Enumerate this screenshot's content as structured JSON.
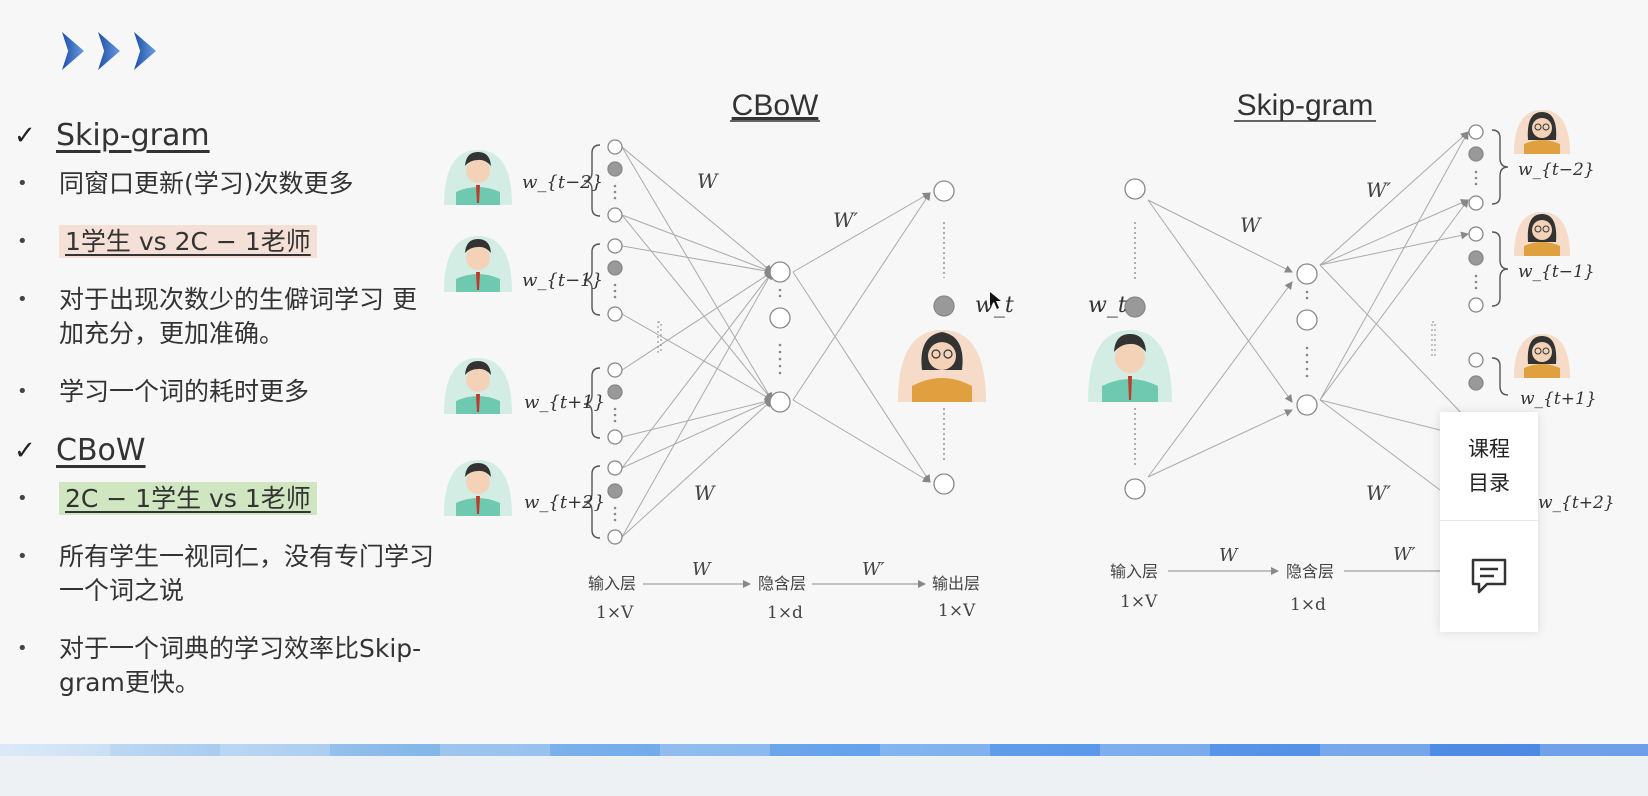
{
  "left": {
    "sections": [
      {
        "title": "Skip-gram",
        "bullets": [
          {
            "text": "同窗口更新(学习)次数更多",
            "highlight": ""
          },
          {
            "text": "1学生 vs 2C − 1老师",
            "highlight": "pink"
          },
          {
            "text": "对于出现次数少的生僻词学习 更加充分，更加准确。",
            "highlight": ""
          },
          {
            "text": "学习一个词的耗时更多",
            "highlight": ""
          }
        ]
      },
      {
        "title": "CBoW",
        "bullets": [
          {
            "text": "2C − 1学生 vs 1老师",
            "highlight": "green"
          },
          {
            "text": "所有学生一视同仁，没有专门学习一个词之说",
            "highlight": ""
          },
          {
            "text": "对于一个词典的学习效率比Skip-gram更快。",
            "highlight": ""
          }
        ]
      }
    ]
  },
  "cbow": {
    "title": "CBoW",
    "inputs": [
      "w_{t−2}",
      "w_{t−1}",
      "w_{t+1}",
      "w_{t+2}"
    ],
    "weight_in": "W",
    "weight_out": "W′",
    "output_word": "w_t",
    "bottom": {
      "input_layer": "输入层",
      "input_dim": "1×V",
      "hidden_layer": "隐含层",
      "hidden_dim": "1×d",
      "output_layer": "输出层",
      "output_dim": "1×V",
      "arrow1": "W",
      "arrow2": "W′"
    }
  },
  "skipgram": {
    "title": "Skip-gram",
    "input_word": "w_t",
    "outputs": [
      "w_{t−2}",
      "w_{t−1}",
      "w_{t+1}",
      "w_{t+2}"
    ],
    "weight_in": "W",
    "weight_out": "W′",
    "bottom": {
      "input_layer": "输入层",
      "input_dim": "1×V",
      "hidden_layer": "隐含层",
      "hidden_dim": "1×d",
      "arrow1": "W",
      "arrow2": "W′"
    }
  },
  "side_panel": {
    "toc_line1": "课程",
    "toc_line2": "目录"
  },
  "icons": {
    "header": "chevron-right-icon",
    "check": "checkmark-icon",
    "chat": "chat-icon"
  }
}
